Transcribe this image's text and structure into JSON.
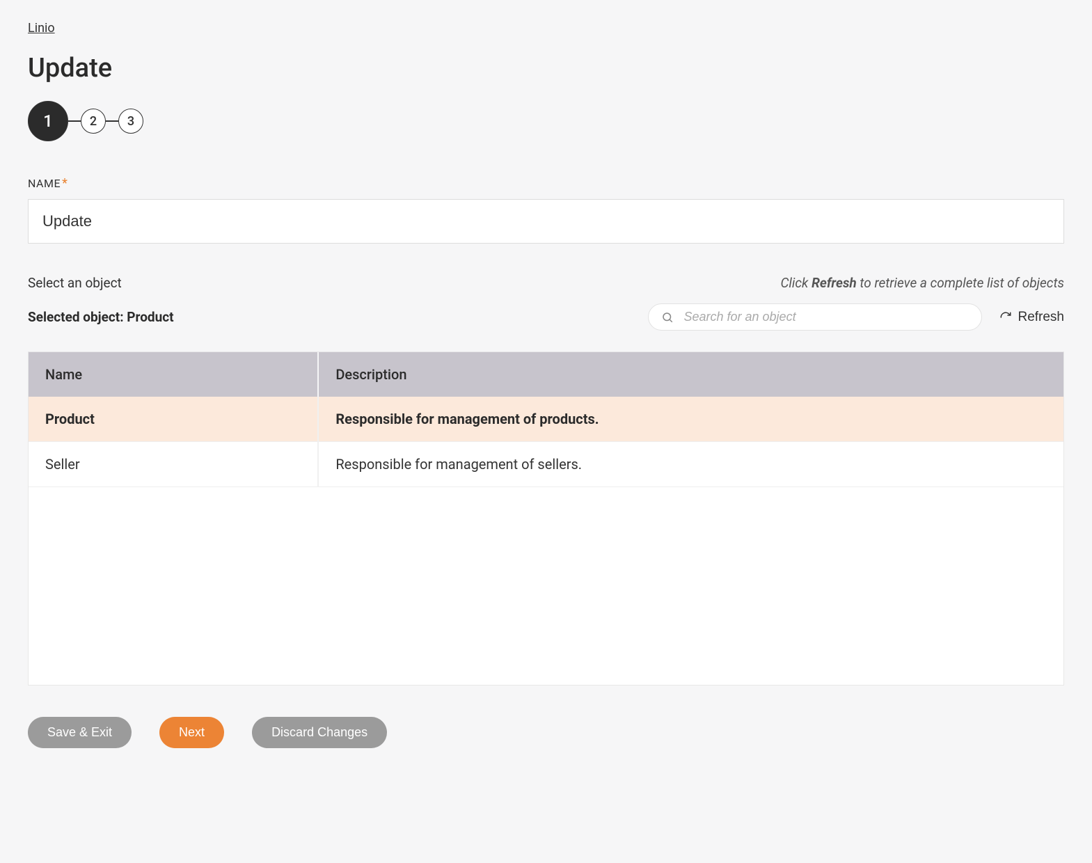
{
  "breadcrumb": {
    "link": "Linio"
  },
  "page": {
    "title": "Update"
  },
  "stepper": {
    "steps": [
      "1",
      "2",
      "3"
    ]
  },
  "form": {
    "name_label": "NAME",
    "name_value": "Update"
  },
  "section": {
    "select_label": "Select an object",
    "hint_pre": "Click ",
    "hint_bold": "Refresh",
    "hint_post": " to retrieve a complete list of objects",
    "selected_prefix": "Selected object: ",
    "selected_value": "Product"
  },
  "search": {
    "placeholder": "Search for an object"
  },
  "refresh": {
    "label": "Refresh"
  },
  "table": {
    "headers": {
      "name": "Name",
      "description": "Description"
    },
    "rows": [
      {
        "name": "Product",
        "description": "Responsible for management of products.",
        "selected": true
      },
      {
        "name": "Seller",
        "description": "Responsible for management of sellers.",
        "selected": false
      }
    ]
  },
  "buttons": {
    "save_exit": "Save & Exit",
    "next": "Next",
    "discard": "Discard Changes"
  }
}
